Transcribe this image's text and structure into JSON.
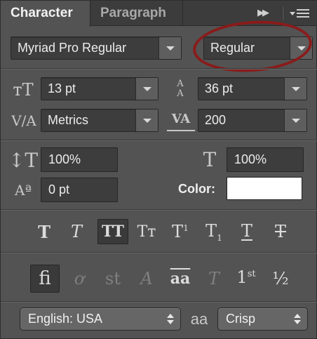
{
  "tabs": {
    "character": "Character",
    "paragraph": "Paragraph"
  },
  "font": {
    "family": "Myriad Pro Regular",
    "style": "Regular"
  },
  "size": {
    "font_size": "13 pt",
    "leading": "36 pt"
  },
  "spacing": {
    "kerning": "Metrics",
    "tracking": "200"
  },
  "scale": {
    "vertical": "100%",
    "horizontal": "100%"
  },
  "baseline": {
    "shift": "0 pt"
  },
  "color": {
    "label": "Color:",
    "value": "#ffffff"
  },
  "styles": {
    "bold": "T",
    "italic": "T",
    "all_caps": "TT",
    "small_caps": "Tт",
    "superscript_base": "T",
    "superscript_mark": "1",
    "subscript_base": "T",
    "subscript_mark": "1",
    "underline": "T",
    "strikethrough": "T"
  },
  "opentype": {
    "ligatures": "fi",
    "discretionary": "ơ",
    "swash": "st",
    "stylistic": "A",
    "ordinals_base": "1",
    "ordinals_sup": "st",
    "fractions": "½",
    "oldstyle": "aa",
    "titling": "T"
  },
  "language": {
    "value": "English: USA"
  },
  "antialias": {
    "icon": "aa",
    "value": "Crisp"
  },
  "accent_colors": {
    "annotation": "#8a1b1b",
    "panel": "#535353",
    "field": "#3d3d3d"
  }
}
